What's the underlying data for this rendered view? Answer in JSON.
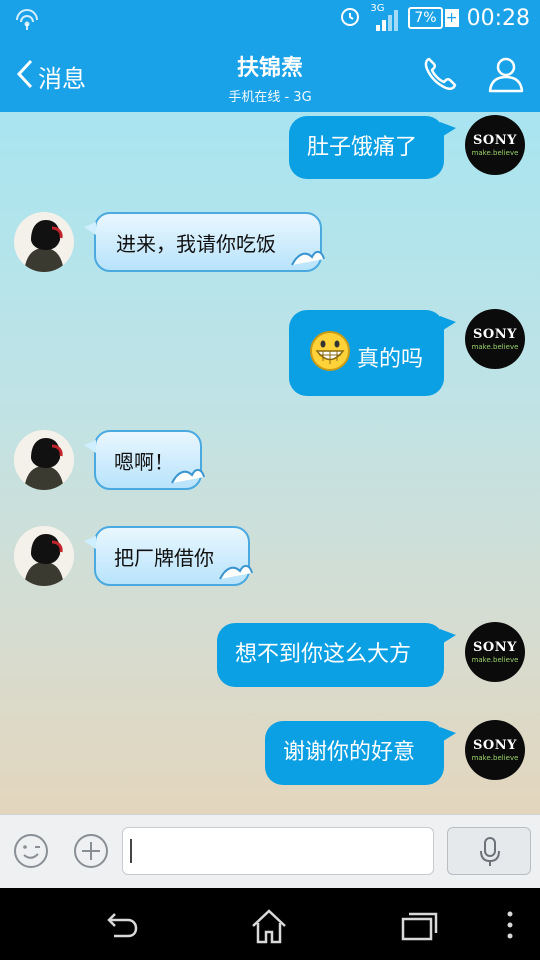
{
  "status_bar": {
    "network": "3G",
    "battery": "7%",
    "time": "00:28",
    "icons": [
      "wifi-signal-icon",
      "alarm-icon",
      "signal-bars-icon",
      "battery-icon",
      "charging-icon"
    ]
  },
  "header": {
    "back_label": "消息",
    "contact_name": "扶锦焘",
    "contact_status": "手机在线 - 3G",
    "icons": [
      "chevron-left-icon",
      "phone-icon",
      "profile-icon"
    ],
    "accent_color": "#1aa2e8"
  },
  "avatars": {
    "self_brand": "SONY",
    "self_tagline": "make.believe"
  },
  "messages": [
    {
      "from": "self",
      "text": "肚子饿痛了"
    },
    {
      "from": "contact",
      "text": "进来，我请你吃饭"
    },
    {
      "from": "self",
      "emoji": "grin-emoji",
      "text": "真的吗"
    },
    {
      "from": "contact",
      "text": "嗯啊！"
    },
    {
      "from": "contact",
      "text": "把厂牌借你"
    },
    {
      "from": "self",
      "text": "想不到你这么大方"
    },
    {
      "from": "self",
      "text": "谢谢你的好意"
    }
  ],
  "input_bar": {
    "value": "",
    "icons": [
      "emoji-face-icon",
      "plus-icon",
      "microphone-icon"
    ]
  },
  "nav_bar": {
    "icons": [
      "back-arrow-icon",
      "home-icon",
      "recent-apps-icon",
      "overflow-menu-icon"
    ]
  },
  "colors": {
    "outgoing_bubble": "#0ba0e3",
    "incoming_bubble": "#cfeefe"
  }
}
